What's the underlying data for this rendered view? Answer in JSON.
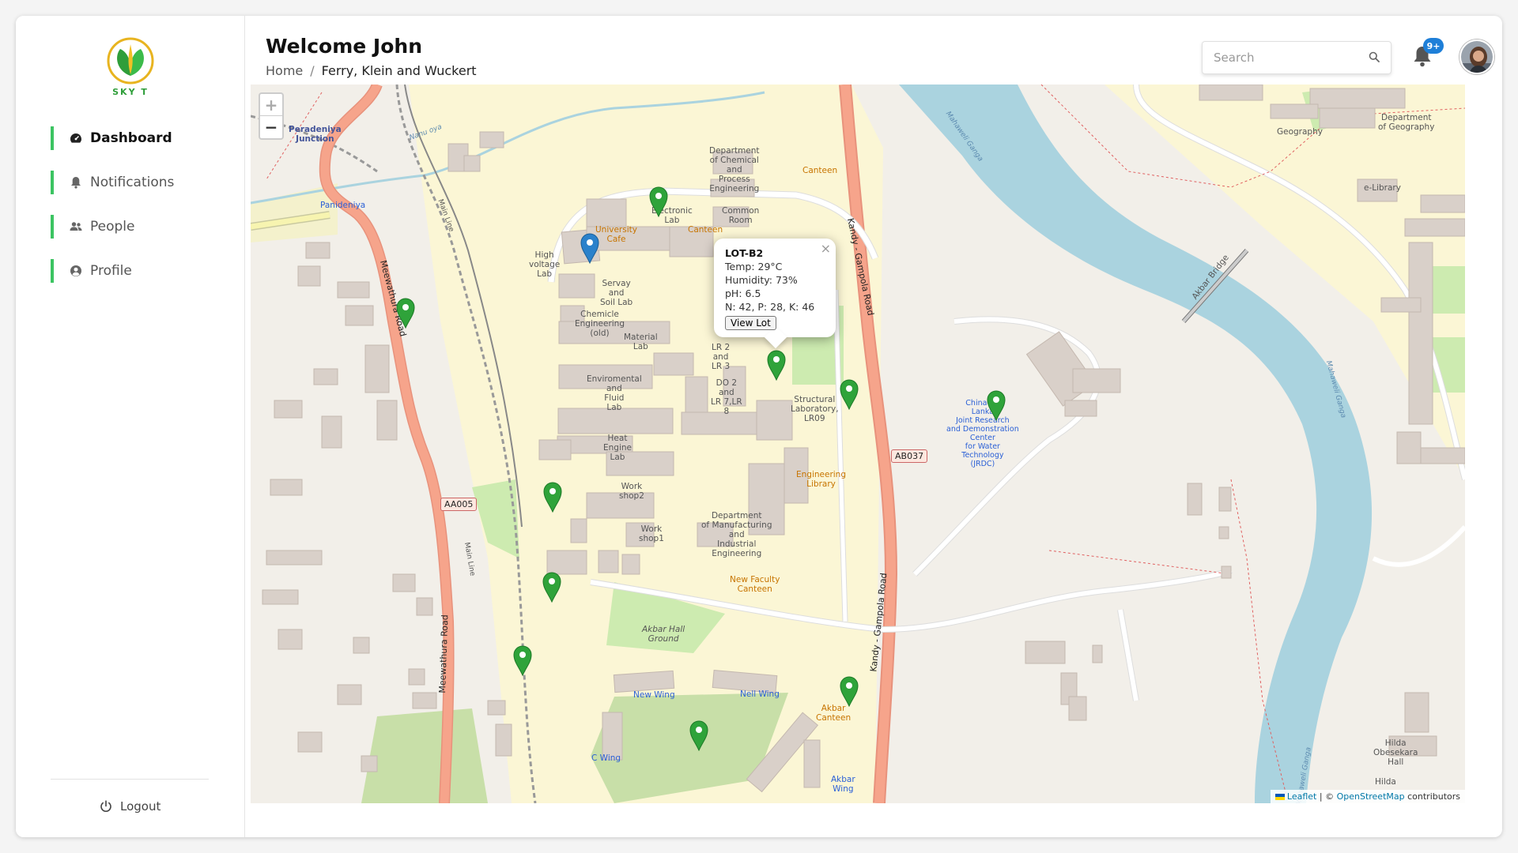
{
  "brand": {
    "name": "SKY T"
  },
  "nav": [
    {
      "label": "Dashboard",
      "icon": "dashboard-icon",
      "active": true
    },
    {
      "label": "Notifications",
      "icon": "bell-icon",
      "active": false
    },
    {
      "label": "People",
      "icon": "people-icon",
      "active": false
    },
    {
      "label": "Profile",
      "icon": "profile-icon",
      "active": false
    }
  ],
  "logout_label": "Logout",
  "header": {
    "title": "Welcome John",
    "breadcrumb": {
      "home": "Home",
      "separator": "/",
      "current": "Ferry, Klein and Wuckert"
    }
  },
  "search": {
    "placeholder": "Search",
    "value": ""
  },
  "notifications": {
    "badge": "9+"
  },
  "colors": {
    "accent": "#3cc462",
    "badge": "#1e7fd8",
    "marker_green": "#2fa33a",
    "marker_blue": "#2a81cb"
  },
  "map": {
    "zoom_in": "+",
    "zoom_out": "−",
    "popup": {
      "title": "LOT-B2",
      "temp": "Temp: 29°C",
      "humidity": "Humidity: 73%",
      "ph": "pH: 6.5",
      "npk": "N: 42, P: 28, K: 46",
      "button": "View Lot",
      "close": "×"
    },
    "attribution": {
      "leaflet": "Leaflet",
      "sep": " | © ",
      "osm": "OpenStreetMap",
      "suffix": " contributors"
    },
    "labels": {
      "peradeniya": "Peradeniya\nJunction",
      "panideniya": "Panideniya",
      "nanu_oya": "Nanu oya",
      "main_line_top": "Main Line",
      "main_line": "Main Line",
      "meewathura1": "Meewathura Road",
      "meewathura2": "Meewathura Road",
      "aa005": "AA005",
      "ab037": "AB037",
      "kandy_road1": "Kandy - Gampola Road",
      "kandy_road2": "Kandy - Gampola Road",
      "mahaweli1": "Mahaweli Ganga",
      "mahaweli2": "Mahaweli Ganga",
      "mahaweli3": "Mahaweli Ganga",
      "akbar_bridge": "Akbar Bridge",
      "dept_chem": "Department\nof Chemical\nand\nProcess\nEngineering",
      "canteen1": "Canteen",
      "electronic_lab": "Electronic\nLab",
      "common_room": "Common\nRoom",
      "university_cafe": "University\nCafe",
      "canteen2": "Canteen",
      "high_voltage": "High\nvoltage\nLab",
      "servay_soil": "Servay\nand\nSoil Lab",
      "chem_eng_old": "Chemicle\nEngineering\n(old)",
      "material_lab": "Material\nLab",
      "lr2": "LR 2\nand\nLR 3",
      "env_fluid": "Enviromental\nand\nFluid\nLab",
      "do2": "DO 2\nand\nLR 7,LR\n8",
      "structural": "Structural\nLaboratory,\nLR09",
      "heat_engine": "Heat\nEngine\nLab",
      "eng_library": "Engineering\nLibrary",
      "workshop2": "Work\nshop2",
      "workshop1": "Work\nshop1",
      "dept_mfg": "Department\nof Manufacturing\nand\nIndustrial\nEngineering",
      "new_faculty_canteen": "New Faculty\nCanteen",
      "akbar_hall_ground": "Akbar Hall\nGround",
      "new_wing": "New Wing",
      "nell_wing": "Nell Wing",
      "akbar_canteen": "Akbar\nCanteen",
      "c_wing": "C Wing",
      "akbar_wing": "Akbar\nWing",
      "geography": "Geography",
      "dept_geography": "Department\nof Geography",
      "e_library": "e-Library",
      "jrdc": "China-Sri\nLanka\nJoint Research\nand Demonstration\nCenter\nfor Water\nTechnology\n(JRDC)",
      "hilda1": "Hilda\nObesekara\nHall",
      "hilda2": "Hilda"
    }
  }
}
